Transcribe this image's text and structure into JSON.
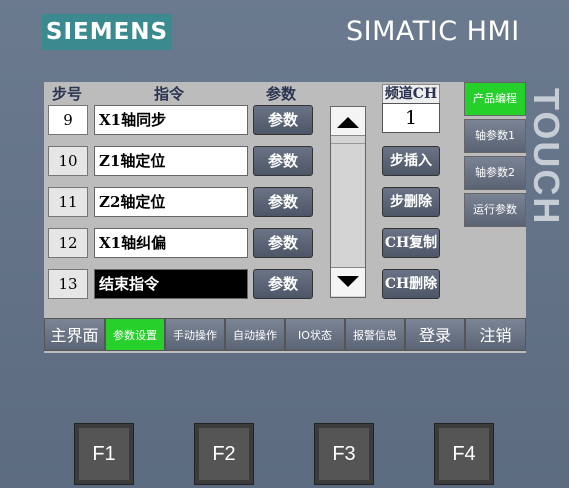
{
  "brand": {
    "logo": "SIEMENS",
    "product": "SIMATIC HMI",
    "touch": "TOUCH"
  },
  "headers": {
    "step": "步号",
    "instruction": "指令",
    "param": "参数",
    "channel": "频道CH"
  },
  "channel_value": "1",
  "rows": [
    {
      "step": "9",
      "instruction": "X1轴同步",
      "param": "参数"
    },
    {
      "step": "10",
      "instruction": "Z1轴定位",
      "param": "参数"
    },
    {
      "step": "11",
      "instruction": "Z2轴定位",
      "param": "参数"
    },
    {
      "step": "12",
      "instruction": "X1轴纠偏",
      "param": "参数"
    },
    {
      "step": "13",
      "instruction": "结束指令",
      "param": "参数"
    }
  ],
  "step_actions": {
    "insert": "步插入",
    "delete": "步删除",
    "ch_copy": "CH复制",
    "ch_delete": "CH删除"
  },
  "side_menu": [
    {
      "label": "产品编程",
      "active": true
    },
    {
      "label": "轴参数1"
    },
    {
      "label": "轴参数2"
    },
    {
      "label": "运行参数"
    }
  ],
  "nav": [
    {
      "label": "主界面"
    },
    {
      "label": "参数设置",
      "active": true
    },
    {
      "label": "手动操作"
    },
    {
      "label": "自动操作"
    },
    {
      "label": "IO状态"
    },
    {
      "label": "报警信息"
    },
    {
      "label": "登录"
    },
    {
      "label": "注销"
    }
  ],
  "function_keys": [
    "F1",
    "F2",
    "F3",
    "F4"
  ],
  "colors": {
    "active_green": "#27d02b",
    "logo_teal": "#3b8a8f",
    "button_gray": "#5b6474"
  }
}
